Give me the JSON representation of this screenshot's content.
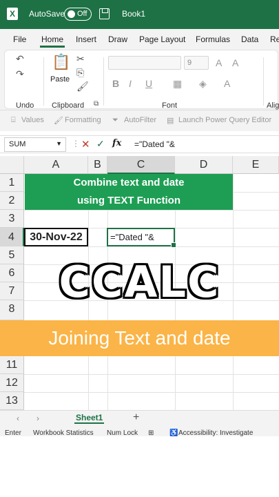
{
  "titlebar": {
    "autosave_label": "AutoSave",
    "autosave_state": "Off",
    "book_name": "Book1"
  },
  "menu": [
    "File",
    "Home",
    "Insert",
    "Draw",
    "Page Layout",
    "Formulas",
    "Data",
    "Re"
  ],
  "ribbon": {
    "undo_label": "Undo",
    "paste_label": "Paste",
    "clipboard_label": "Clipboard",
    "font_size": "9",
    "font_label": "Font",
    "align_label": "Alig"
  },
  "quick_toolbar": [
    "Values",
    "Formatting",
    "AutoFilter",
    "Launch Power Query Editor"
  ],
  "formula_bar": {
    "name_box": "SUM",
    "fx": "fx",
    "value": "=\"Dated \"&"
  },
  "columns": [
    "A",
    "B",
    "C",
    "D",
    "E"
  ],
  "rows": [
    "1",
    "2",
    "3",
    "4",
    "5",
    "6",
    "7",
    "8",
    "11",
    "12",
    "13"
  ],
  "banner": {
    "line1": "Combine text and date",
    "line2": "using  TEXT Function"
  },
  "cells": {
    "a4": "30-Nov-22",
    "c4": "=\"Dated \"&"
  },
  "overlay": {
    "logo_text": "CCALC",
    "subtitle": "Joining Text and date"
  },
  "sheets": {
    "active": "Sheet1",
    "add": "+"
  },
  "status": [
    "Enter",
    "Workbook Statistics",
    "Num Lock",
    "Accessibility: Investigate"
  ],
  "colors": {
    "excel_green": "#1e7145",
    "banner_green": "#1e9e54",
    "orange": "#fbb447"
  }
}
